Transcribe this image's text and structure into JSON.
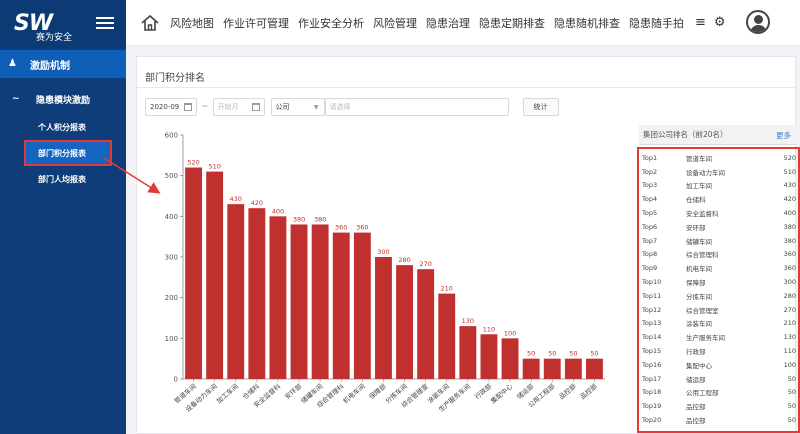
{
  "app": {
    "logo_text": "SW",
    "logo_sub": "赛为安全"
  },
  "sidebar": {
    "section": "激励机制",
    "group": "隐患模块激励",
    "items": [
      {
        "label": "个人积分报表"
      },
      {
        "label": "部门积分报表"
      },
      {
        "label": "部门人均报表"
      }
    ],
    "selected_index": 1
  },
  "topnav": {
    "items": [
      "风险地图",
      "作业许可管理",
      "作业安全分析",
      "风险管理",
      "隐患治理",
      "隐患定期排查",
      "隐患随机排查",
      "隐患随手拍"
    ]
  },
  "page": {
    "title": "部门积分排名"
  },
  "filters": {
    "date_from": "2020-09",
    "date_to_placeholder": "开始月",
    "company": "公司",
    "select_placeholder": "请选择",
    "stat_button": "统计"
  },
  "ranking": {
    "header": "集团公司排名（前20名）",
    "more": "更多",
    "rows": [
      {
        "rank": "Top1",
        "name": "管道车间",
        "value": "520"
      },
      {
        "rank": "Top2",
        "name": "设备动力车间",
        "value": "510"
      },
      {
        "rank": "Top3",
        "name": "加工车间",
        "value": "430"
      },
      {
        "rank": "Top4",
        "name": "仓储科",
        "value": "420"
      },
      {
        "rank": "Top5",
        "name": "安全监督科",
        "value": "400"
      },
      {
        "rank": "Top6",
        "name": "安环部",
        "value": "380"
      },
      {
        "rank": "Top7",
        "name": "储罐车间",
        "value": "380"
      },
      {
        "rank": "Top8",
        "name": "综合管理科",
        "value": "360"
      },
      {
        "rank": "Top9",
        "name": "机电车间",
        "value": "360"
      },
      {
        "rank": "Top10",
        "name": "保障部",
        "value": "300"
      },
      {
        "rank": "Top11",
        "name": "分拣车间",
        "value": "280"
      },
      {
        "rank": "Top12",
        "name": "综合管理室",
        "value": "270"
      },
      {
        "rank": "Top13",
        "name": "涂装车间",
        "value": "210"
      },
      {
        "rank": "Top14",
        "name": "生产服务车间",
        "value": "130"
      },
      {
        "rank": "Top15",
        "name": "行政部",
        "value": "110"
      },
      {
        "rank": "Top16",
        "name": "集配中心",
        "value": "100"
      },
      {
        "rank": "Top17",
        "name": "储运部",
        "value": "50"
      },
      {
        "rank": "Top18",
        "name": "公用工程部",
        "value": "50"
      },
      {
        "rank": "Top19",
        "name": "品控部",
        "value": "50"
      },
      {
        "rank": "Top20",
        "name": "品控部",
        "value": "50"
      }
    ]
  },
  "colors": {
    "sidebar_bg": "#0f3d79",
    "active_bg": "#0f5eb8",
    "bar": "#c0302e",
    "annotation": "#e53935",
    "link": "#3a7bd5"
  },
  "chart_data": {
    "type": "bar",
    "title": "",
    "xlabel": "",
    "ylabel": "",
    "ylim": [
      0,
      600
    ],
    "yticks": [
      0,
      100,
      200,
      300,
      400,
      500,
      600
    ],
    "grid": false,
    "categories": [
      "管道车间",
      "设备动力车间",
      "加工车间",
      "仓储科",
      "安全监督科",
      "安环部",
      "储罐车间",
      "综合管理科",
      "机电车间",
      "保障部",
      "分拣车间",
      "综合管理室",
      "涂装车间",
      "生产服务车间",
      "行政部",
      "集配中心",
      "储运部",
      "公用工程部",
      "品控部",
      "品控部"
    ],
    "values": [
      520,
      510,
      430,
      420,
      400,
      380,
      380,
      360,
      360,
      300,
      280,
      270,
      210,
      130,
      110,
      100,
      50,
      50,
      50,
      50
    ]
  }
}
